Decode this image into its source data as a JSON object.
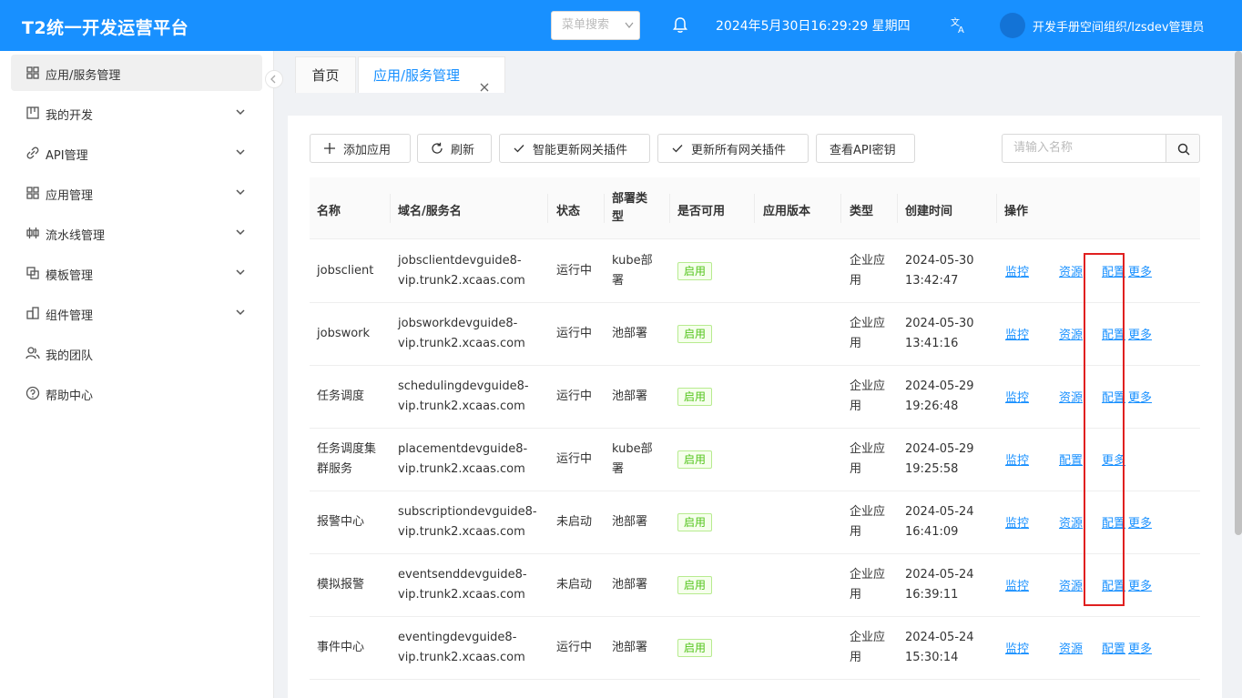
{
  "header": {
    "title": "T2统一开发运营平台",
    "menu_search_placeholder": "菜单搜索",
    "datetime": "2024年5月30日16:29:29 星期四",
    "user": "开发手册空间组织/lzsdev管理员",
    "accent_color": "#1890ff"
  },
  "sidebar": {
    "items": [
      {
        "label": "应用/服务管理",
        "icon": "app-grid-icon",
        "active": true
      },
      {
        "label": "我的开发",
        "icon": "board-icon"
      },
      {
        "label": "API管理",
        "icon": "link-icon"
      },
      {
        "label": "应用管理",
        "icon": "grid-icon"
      },
      {
        "label": "流水线管理",
        "icon": "pipeline-icon"
      },
      {
        "label": "模板管理",
        "icon": "template-icon"
      },
      {
        "label": "组件管理",
        "icon": "component-icon"
      },
      {
        "label": "我的团队",
        "icon": "team-icon"
      },
      {
        "label": "帮助中心",
        "icon": "help-icon"
      }
    ]
  },
  "tabs": {
    "home": "首页",
    "current": "应用/服务管理"
  },
  "toolbar": {
    "add": "添加应用",
    "refresh": "刷新",
    "smart_update": "智能更新网关插件",
    "update_all": "更新所有网关插件",
    "view_api_key": "查看API密钥",
    "search_placeholder": "请输入名称"
  },
  "table": {
    "headers": [
      "名称",
      "域名/服务名",
      "状态",
      "部署类型",
      "是否可用",
      "应用版本",
      "类型",
      "创建时间",
      "操作"
    ],
    "header_lines": {
      "deploy_type": [
        "部署类",
        "型"
      ]
    },
    "rows": [
      {
        "name": [
          "jobsclient"
        ],
        "domain": [
          "jobsclientdevguide8-",
          "vip.trunk2.xcaas.com"
        ],
        "status": "运行中",
        "deploy": [
          "kube部",
          "署"
        ],
        "available": "启用",
        "version": "",
        "type": [
          "企业应",
          "用"
        ],
        "created": [
          "2024-05-30",
          "13:42:47"
        ],
        "actions": [
          "监控",
          "资源",
          "配置",
          "更多"
        ]
      },
      {
        "name": [
          "jobswork"
        ],
        "domain": [
          "jobsworkdevguide8-",
          "vip.trunk2.xcaas.com"
        ],
        "status": "运行中",
        "deploy": [
          "池部署"
        ],
        "available": "启用",
        "version": "",
        "type": [
          "企业应",
          "用"
        ],
        "created": [
          "2024-05-30",
          "13:41:16"
        ],
        "actions": [
          "监控",
          "资源",
          "配置",
          "更多"
        ]
      },
      {
        "name": [
          "任务调度"
        ],
        "domain": [
          "schedulingdevguide8-",
          "vip.trunk2.xcaas.com"
        ],
        "status": "运行中",
        "deploy": [
          "池部署"
        ],
        "available": "启用",
        "version": "",
        "type": [
          "企业应",
          "用"
        ],
        "created": [
          "2024-05-29",
          "19:26:48"
        ],
        "actions": [
          "监控",
          "资源",
          "配置",
          "更多"
        ]
      },
      {
        "name": [
          "任务调度集",
          "群服务"
        ],
        "domain": [
          "placementdevguide8-",
          "vip.trunk2.xcaas.com"
        ],
        "status": "运行中",
        "deploy": [
          "kube部",
          "署"
        ],
        "available": "启用",
        "version": "",
        "type": [
          "企业应",
          "用"
        ],
        "created": [
          "2024-05-29",
          "19:25:58"
        ],
        "actions": [
          "监控",
          "配置",
          "更多"
        ]
      },
      {
        "name": [
          "报警中心"
        ],
        "domain": [
          "subscriptiondevguide8-",
          "vip.trunk2.xcaas.com"
        ],
        "status": "未启动",
        "deploy": [
          "池部署"
        ],
        "available": "启用",
        "version": "",
        "type": [
          "企业应",
          "用"
        ],
        "created": [
          "2024-05-24",
          "16:41:09"
        ],
        "actions": [
          "监控",
          "资源",
          "配置",
          "更多"
        ]
      },
      {
        "name": [
          "模拟报警"
        ],
        "domain": [
          "eventsenddevguide8-",
          "vip.trunk2.xcaas.com"
        ],
        "status": "未启动",
        "deploy": [
          "池部署"
        ],
        "available": "启用",
        "version": "",
        "type": [
          "企业应",
          "用"
        ],
        "created": [
          "2024-05-24",
          "16:39:11"
        ],
        "actions": [
          "监控",
          "资源",
          "配置",
          "更多"
        ]
      },
      {
        "name": [
          "事件中心"
        ],
        "domain": [
          "eventingdevguide8-",
          "vip.trunk2.xcaas.com"
        ],
        "status": "运行中",
        "deploy": [
          "池部署"
        ],
        "available": "启用",
        "version": "",
        "type": [
          "企业应",
          "用"
        ],
        "created": [
          "2024-05-24",
          "15:30:14"
        ],
        "actions": [
          "监控",
          "资源",
          "配置",
          "更多"
        ]
      }
    ]
  }
}
